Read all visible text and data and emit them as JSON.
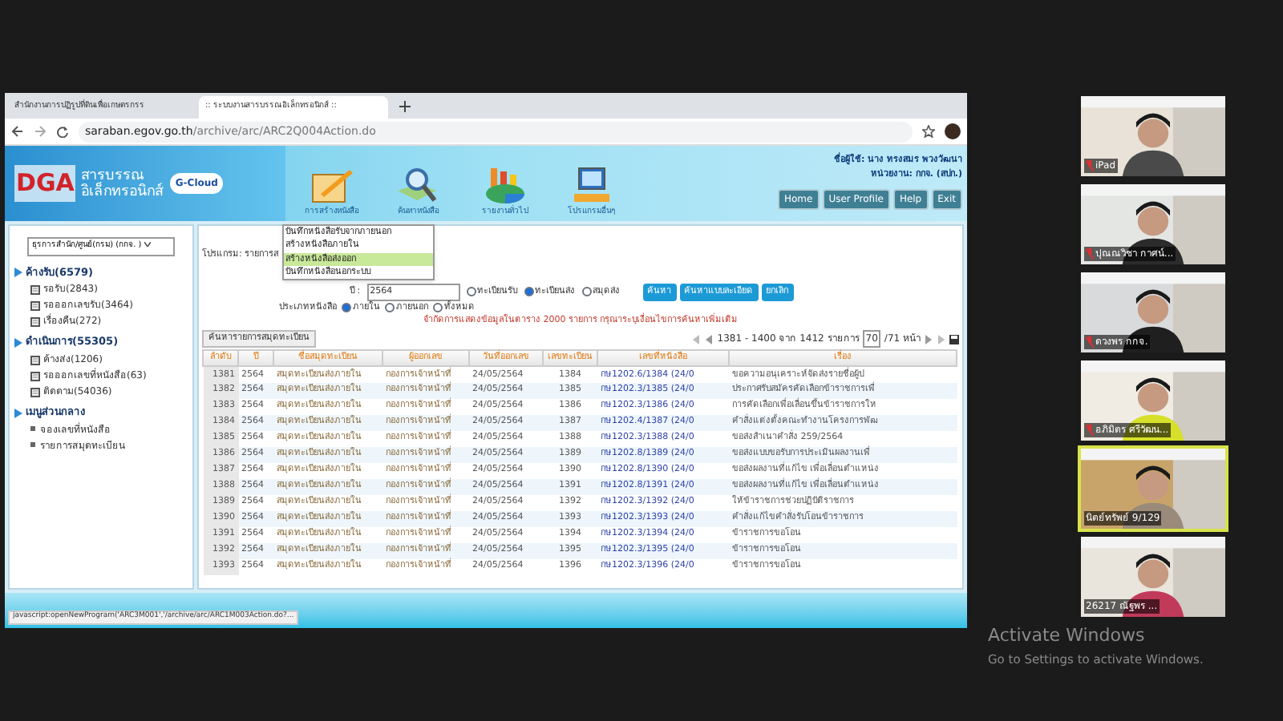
{
  "browser": {
    "tabs": [
      {
        "title": "สำนักงานการปฏิรูปที่ดินเพื่อเกษตรกรร",
        "selected": false
      },
      {
        "title": ":: ระบบงานสารบรรณอิเล็กทรอนิกส์ ::",
        "selected": true
      }
    ],
    "url": {
      "host": "saraban.egov.go.th",
      "path": "/archive/arc/ARC2Q004Action.do"
    }
  },
  "site": {
    "logo": {
      "brand": "DGA",
      "line1": "สารบรรณ",
      "line2": "อิเล็กทรอนิกส์",
      "cloud": "G-Cloud"
    },
    "menu": [
      {
        "label": "การสร้างหนังสือ",
        "kind": "create"
      },
      {
        "label": "ค้นหาหนังสือ",
        "kind": "search"
      },
      {
        "label": "รายงานทั่วไป",
        "kind": "report"
      },
      {
        "label": "โปรแกรมอื่นๆ",
        "kind": "program"
      }
    ],
    "user": {
      "name": "ชื่อผู้ใช้: นาง ทรงสมร พวงวัฒนา",
      "unit": "หน่วยงาน: กกจ. (สปก.)"
    },
    "buttons": [
      "Home",
      "User Profile",
      "Help",
      "Exit"
    ]
  },
  "dropdown": [
    {
      "label": "บันทึกหนังสือรับจากภายนอก",
      "selected": false
    },
    {
      "label": "สร้างหนังสือภายใน",
      "selected": false
    },
    {
      "label": "สร้างหนังสือส่งออก",
      "selected": true
    },
    {
      "label": "บันทึกหนังสือนอกระบบ",
      "selected": false
    }
  ],
  "sidebar": {
    "unit_select": "ธุรการสำนัก/ศูนย์(กรม) (กกจ. )",
    "sections": [
      {
        "title": "ค้างรับ(6579)",
        "items": [
          {
            "label": "รอรับ(2843)",
            "kind": "doc"
          },
          {
            "label": "รอออกเลขรับ(3464)",
            "kind": "doc"
          },
          {
            "label": "เรื่องคืน(272)",
            "kind": "doc"
          }
        ]
      },
      {
        "title": "ดำเนินการ(55305)",
        "items": [
          {
            "label": "ค้างส่ง(1206)",
            "kind": "doc"
          },
          {
            "label": "รอออกเลขที่หนังสือ(63)",
            "kind": "doc"
          },
          {
            "label": "ติดตาม(54036)",
            "kind": "doc"
          }
        ]
      },
      {
        "title": "เมนูส่วนกลาง",
        "items": [
          {
            "label": "จองเลขที่หนังสือ",
            "kind": "bullet"
          },
          {
            "label": "รายการสมุดทะเบียน",
            "kind": "bullet"
          }
        ]
      }
    ]
  },
  "search": {
    "program_label": "โปรแกรม: รายการส",
    "year_label": "ปี :",
    "year": "2564",
    "book_types": [
      {
        "label": "ทะเบียนรับ",
        "selected": false
      },
      {
        "label": "ทะเบียนส่ง",
        "selected": true
      },
      {
        "label": "สมุดส่ง",
        "selected": false
      }
    ],
    "buttons": [
      "ค้นหา",
      "ค้นหาแบบละเอียด",
      "ยกเลิก"
    ],
    "doc_type_label": "ประเภทหนังสือ",
    "doc_types": [
      {
        "label": "ภายใน",
        "selected": true
      },
      {
        "label": "ภายนอก",
        "selected": false
      },
      {
        "label": "ทั้งหมด",
        "selected": false
      }
    ],
    "warning": "จำกัดการแสดงข้อมูลในตาราง 2000 รายการ กรุณาระบุเงื่อนไขการค้นหาเพิ่มเติม"
  },
  "table": {
    "tab": "ค้นหารายการสมุดทะเบียน",
    "pager": {
      "range": "1381 - 1400 จาก 1412 รายการ",
      "page": "70",
      "total": "/71 หน้า"
    },
    "columns": [
      "ลำดับ",
      "ปี",
      "ชื่อสมุดทะเบียน",
      "ผู้ออกเลข",
      "วันที่ออกเลข",
      "เลขทะเบียน",
      "เลขที่หนังสือ",
      "เรื่อง"
    ],
    "rows": [
      [
        "1381",
        "2564",
        "สมุดทะเบียนส่งภายใน",
        "กองการเจ้าหน้าที่",
        "24/05/2564",
        "1384",
        "กษ1202.6/1384 (24/0",
        "ขอความอนุเคราะห์จัดส่งรายชื่อผู้ป"
      ],
      [
        "1382",
        "2564",
        "สมุดทะเบียนส่งภายใน",
        "กองการเจ้าหน้าที่",
        "24/05/2564",
        "1385",
        "กษ1202.3/1385 (24/0",
        "ประกาศรับสมัครคัดเลือกข้าราชการเพื่"
      ],
      [
        "1383",
        "2564",
        "สมุดทะเบียนส่งภายใน",
        "กองการเจ้าหน้าที่",
        "24/05/2564",
        "1386",
        "กษ1202.3/1386 (24/0",
        "การคัดเลือกเพื่อเลื่อนขึ้นข้าราชการให"
      ],
      [
        "1384",
        "2564",
        "สมุดทะเบียนส่งภายใน",
        "กองการเจ้าหน้าที่",
        "24/05/2564",
        "1387",
        "กษ1202.4/1387 (24/0",
        "คำสั่งแต่งตั้งคณะทำงานโครงการพัฒ"
      ],
      [
        "1385",
        "2564",
        "สมุดทะเบียนส่งภายใน",
        "กองการเจ้าหน้าที่",
        "24/05/2564",
        "1388",
        "กษ1202.3/1388 (24/0",
        "ขอส่งสำเนาคำสั่ง 259/2564"
      ],
      [
        "1386",
        "2564",
        "สมุดทะเบียนส่งภายใน",
        "กองการเจ้าหน้าที่",
        "24/05/2564",
        "1389",
        "กษ1202.8/1389 (24/0",
        "ขอส่งแบบขอรับการประเมินผลงานเพื่"
      ],
      [
        "1387",
        "2564",
        "สมุดทะเบียนส่งภายใน",
        "กองการเจ้าหน้าที่",
        "24/05/2564",
        "1390",
        "กษ1202.8/1390 (24/0",
        "ขอส่งผลงานที่แก้ไข เพื่อเลื่อนตำแหน่ง"
      ],
      [
        "1388",
        "2564",
        "สมุดทะเบียนส่งภายใน",
        "กองการเจ้าหน้าที่",
        "24/05/2564",
        "1391",
        "กษ1202.8/1391 (24/0",
        "ขอส่งผลงานที่แก้ไข เพื่อเลื่อนตำแหน่ง"
      ],
      [
        "1389",
        "2564",
        "สมุดทะเบียนส่งภายใน",
        "กองการเจ้าหน้าที่",
        "24/05/2564",
        "1392",
        "กษ1202.3/1392 (24/0",
        "ให้ข้าราชการช่วยปฏิบัติราชการ"
      ],
      [
        "1390",
        "2564",
        "สมุดทะเบียนส่งภายใน",
        "กองการเจ้าหน้าที่",
        "24/05/2564",
        "1393",
        "กษ1202.3/1393 (24/0",
        "คำสั่งแก้ไขคำสั่งรับโอนข้าราชการ"
      ],
      [
        "1391",
        "2564",
        "สมุดทะเบียนส่งภายใน",
        "กองการเจ้าหน้าที่",
        "24/05/2564",
        "1394",
        "กษ1202.3/1394 (24/0",
        "ข้าราชการขอโอน"
      ],
      [
        "1392",
        "2564",
        "สมุดทะเบียนส่งภายใน",
        "กองการเจ้าหน้าที่",
        "24/05/2564",
        "1395",
        "กษ1202.3/1395 (24/0",
        "ข้าราชการขอโอน"
      ],
      [
        "1393",
        "2564",
        "สมุดทะเบียนส่งภายใน",
        "กองการเจ้าหน้าที่",
        "24/05/2564",
        "1396",
        "กษ1202.3/1396 (24/0",
        "ข้าราชการขอโอน"
      ]
    ]
  },
  "status_bar": "javascript:openNewProgram('ARC3M001','/archive/arc/ARC1M003Action.do?...",
  "participants": [
    {
      "name": "iPad",
      "muted": true,
      "speaking": false
    },
    {
      "name": "ปุณณวิชา กาศน์...",
      "muted": true,
      "speaking": false
    },
    {
      "name": "ดวงพร กกจ.",
      "muted": true,
      "speaking": false
    },
    {
      "name": "อภิมิตร ศรีวัฒน...",
      "muted": true,
      "speaking": false
    },
    {
      "name": "นิตย์ทรัพย์ 9/129",
      "muted": false,
      "speaking": true
    },
    {
      "name": "26217 ณัฐพร ...",
      "muted": false,
      "speaking": false
    }
  ],
  "os_notice": {
    "title": "Activate Windows",
    "subtitle": "Go to Settings to activate Windows."
  }
}
